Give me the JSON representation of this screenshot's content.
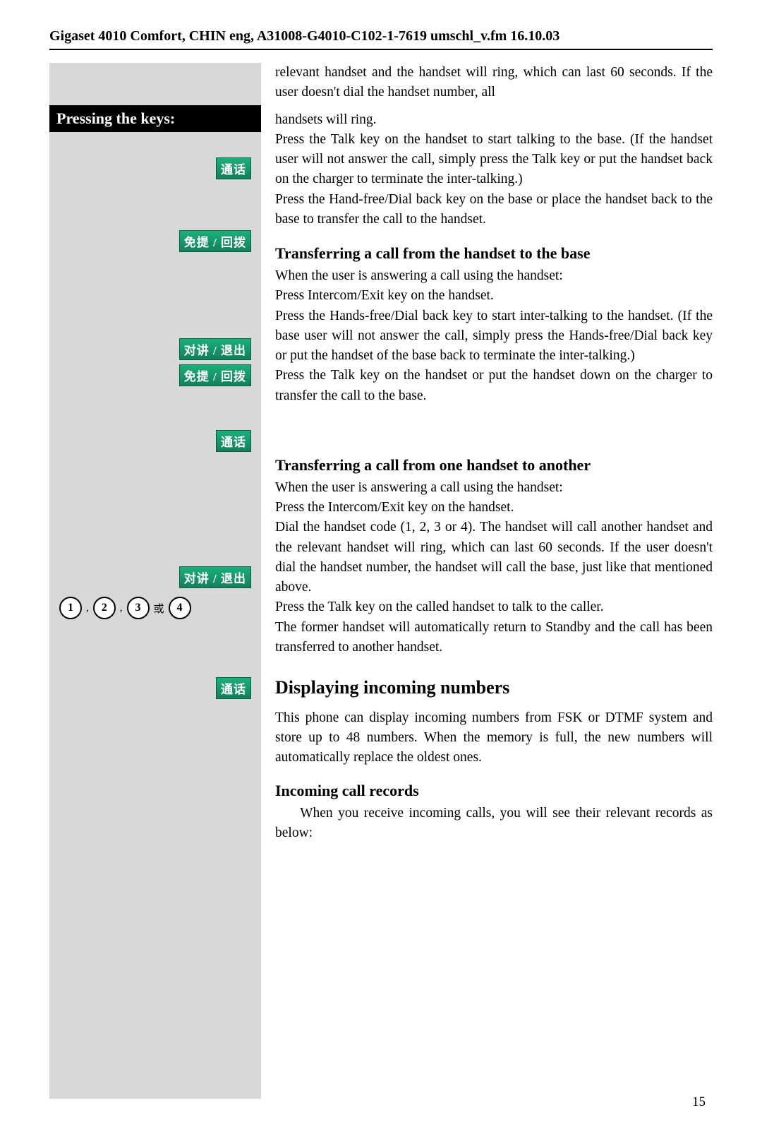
{
  "header": {
    "text": "Gigaset 4010 Comfort, CHIN eng, A31008-G4010-C102-1-7619 umschl_v.fm 16.10.03"
  },
  "sidebar": {
    "title": "Pressing the keys:",
    "keys": {
      "talk": "通话",
      "handfree_dialback": "免提 / 回拨",
      "intercom_exit": "对讲 / 退出",
      "handfree_dialback2": "免提 / 回拨",
      "talk2": "通话",
      "intercom_exit2": "对讲 / 退出",
      "talk3": "通话",
      "or_char": "或"
    },
    "numbers": {
      "n1": "1",
      "n2": "2",
      "n3": "3",
      "n4": "4"
    },
    "commas": {
      "c": ","
    }
  },
  "content": {
    "para_intro": "relevant handset and the handset will ring, which can last 60 seconds. If the user doesn't dial the handset number, all",
    "para_handsets_ring": "handsets will ring.",
    "para_press_talk_base": "Press the Talk key on the handset to start talking to the base. (If the handset user will not answer the call, simply press the Talk key or put the handset back on the charger to terminate the inter-talking.)",
    "para_press_handfree_base": "Press the Hand-free/Dial back key on the base or place the handset back to the base to transfer the call to the handset.",
    "sec1_title": "Transferring a call from the handset to the base",
    "sec1_p1": "When the user is answering a call using the handset:",
    "sec1_p2": "Press Intercom/Exit key on the handset.",
    "sec1_p3": "Press the Hands-free/Dial back key to start inter-talking to the handset. (If the base user will not answer the call, simply press the Hands-free/Dial back key or put the handset of the base back to terminate the inter-talking.)",
    "sec1_p4": "Press the Talk key on the handset or put the handset down on the charger to transfer the call to the base.",
    "sec2_title": "Transferring a call from one handset to another",
    "sec2_p1": "When the user is answering a call using the handset:",
    "sec2_p2": "Press the Intercom/Exit key on the handset.",
    "sec2_p3": "Dial the handset code (1, 2, 3 or 4). The handset will call another handset and the relevant handset will ring, which can last 60 seconds. If the user doesn't dial the handset number, the handset will call the base, just like that mentioned above.",
    "sec2_p4": "Press the Talk key on the called handset to talk to the caller.",
    "sec2_p5": "The former handset will automatically return to Standby and the call has been transferred to another handset.",
    "sec3_title": "Displaying incoming numbers",
    "sec3_p1": "This phone can display incoming numbers from FSK or DTMF system and store up to 48 numbers. When the memory is full, the new numbers will automatically replace the oldest ones.",
    "sub1_title": "Incoming call records",
    "sub1_p1": "When you receive incoming calls, you will see their relevant records as below:"
  },
  "page_number": "15"
}
